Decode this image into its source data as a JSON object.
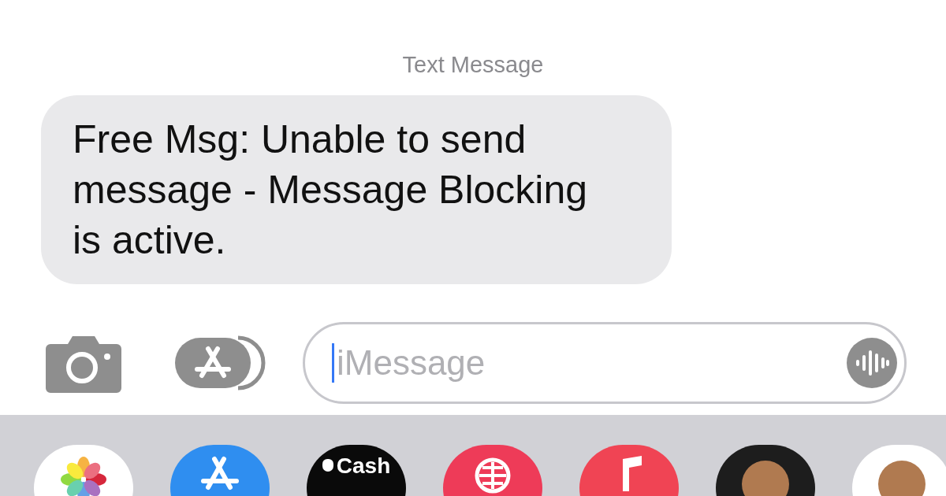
{
  "timestamp_label": "Text Message",
  "messages": [
    {
      "text": "Free Msg: Unable to send message - Message Blocking is active."
    }
  ],
  "compose": {
    "placeholder": "iMessage"
  },
  "app_drawer": [
    {
      "kind": "photos"
    },
    {
      "kind": "store"
    },
    {
      "kind": "cash",
      "label": "Cash"
    },
    {
      "kind": "search"
    },
    {
      "kind": "music"
    },
    {
      "kind": "memoji"
    },
    {
      "kind": "stickers"
    }
  ]
}
